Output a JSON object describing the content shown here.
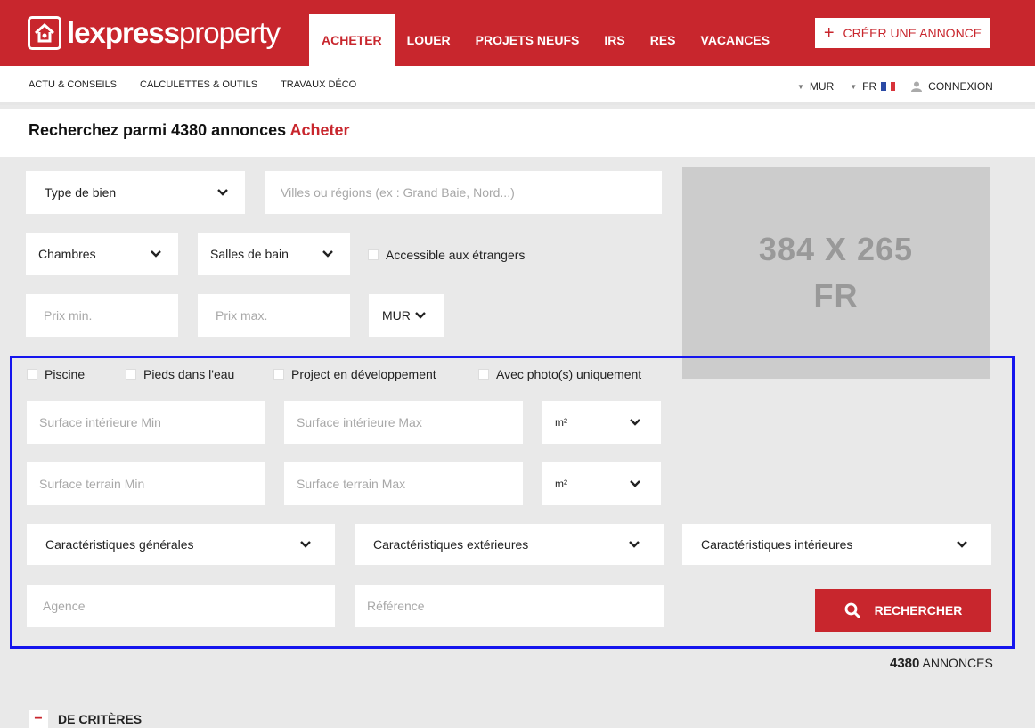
{
  "brand": {
    "logo_bold": "lexpress",
    "logo_light": "property",
    "accent": "#c8262d"
  },
  "main_nav": [
    {
      "label": "ACHETER",
      "active": true
    },
    {
      "label": "LOUER"
    },
    {
      "label": "PROJETS NEUFS"
    },
    {
      "label": "IRS"
    },
    {
      "label": "RES"
    },
    {
      "label": "VACANCES"
    }
  ],
  "create_button": {
    "icon": "plus-icon",
    "label": "CRÉER UNE ANNONCE"
  },
  "sub_nav": {
    "links": [
      "ACTU & CONSEILS",
      "CALCULETTES & OUTILS",
      "TRAVAUX DÉCO"
    ],
    "currency": "MUR",
    "language": "FR",
    "login": "CONNEXION"
  },
  "heading": {
    "prefix": "Recherchez parmi 4380 annonces",
    "accent": "Acheter"
  },
  "form": {
    "type_de_bien": "Type de bien",
    "location_placeholder": "Villes ou régions (ex : Grand Baie, Nord...)",
    "chambres": "Chambres",
    "salles_de_bain": "Salles de bain",
    "accessible": "Accessible aux étrangers",
    "prix_min": "Prix min.",
    "prix_max": "Prix max.",
    "devise": "MUR",
    "piscine": "Piscine",
    "pieds_dans_eau": "Pieds dans l'eau",
    "projet": "Project en développement",
    "avec_photo": "Avec photo(s) uniquement",
    "surface_int_min": "Surface intérieure Min",
    "surface_int_max": "Surface intérieure Max",
    "unit_1": "m²",
    "surface_ter_min": "Surface terrain Min",
    "surface_ter_max": "Surface terrain Max",
    "unit_2": "m²",
    "carac_generales": "Caractéristiques générales",
    "carac_exterieures": "Caractéristiques extérieures",
    "carac_interieures": "Caractéristiques intérieures",
    "agence": "Agence",
    "reference": "Référence",
    "search_label": "RECHERCHER"
  },
  "ad": {
    "line1": "384 X 265",
    "line2": "FR"
  },
  "results": {
    "count": "4380",
    "label": "ANNONCES"
  },
  "less_criteria": {
    "icon": "minus-icon",
    "label": "DE CRITÈRES"
  }
}
